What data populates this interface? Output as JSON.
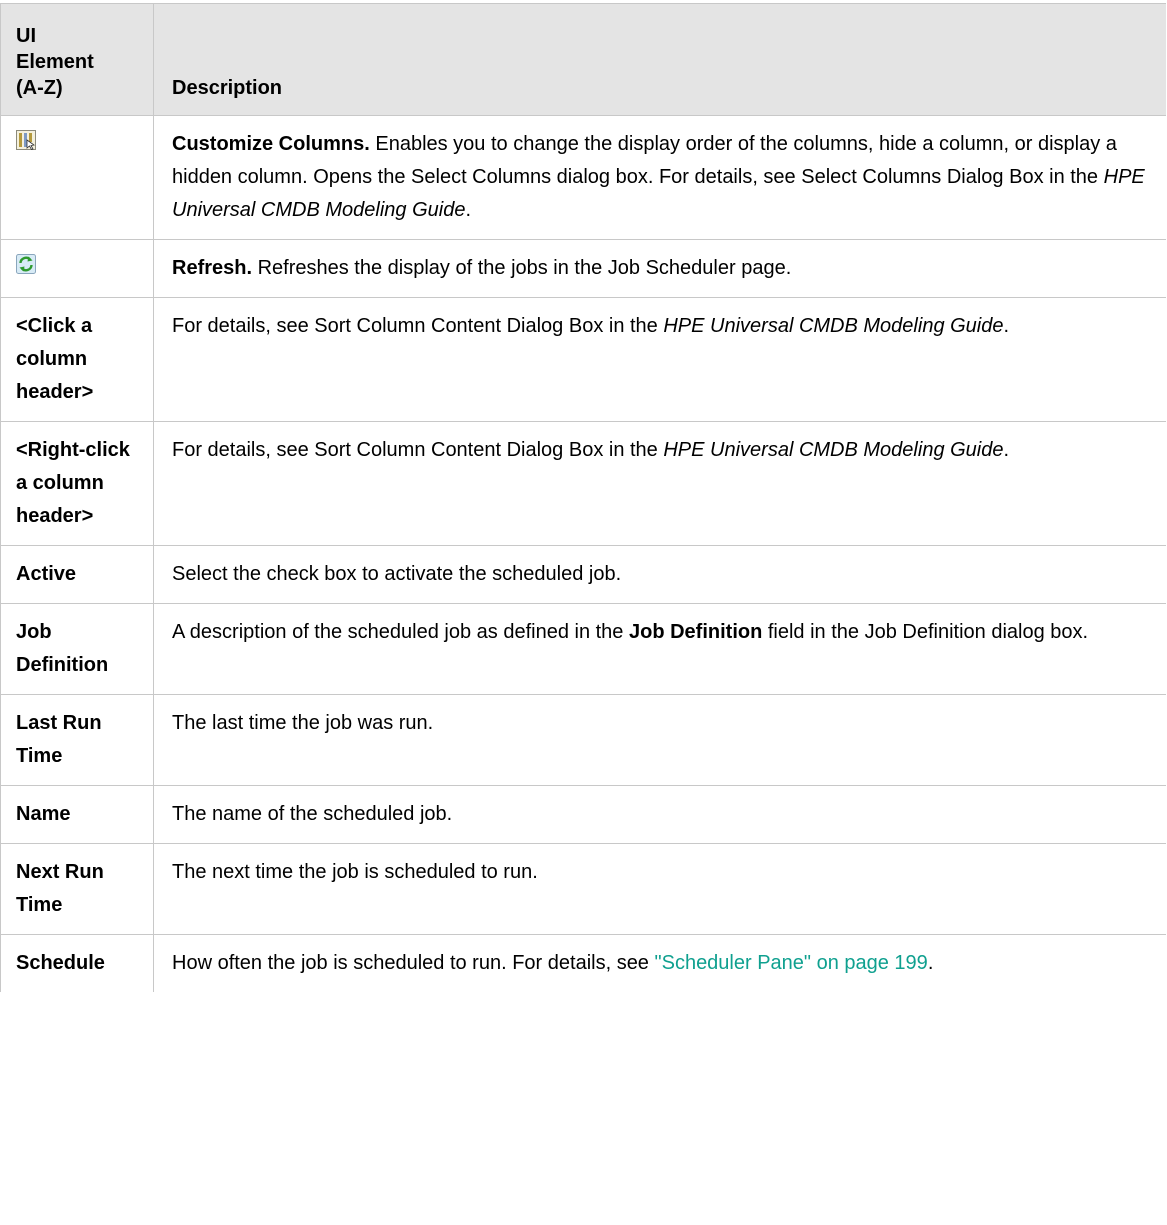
{
  "header": {
    "col1": "UI Element (A-Z)",
    "col1_lines": [
      "UI",
      "Element",
      "(A-Z)"
    ],
    "col2": "Description"
  },
  "rows": [
    {
      "element_icon": "customize-columns-icon",
      "bold": "Customize Columns.",
      "text": " Enables you to change the display order of the columns, hide a column, or display a hidden column. Opens the Select Columns dialog box. For details, see Select Columns Dialog Box in the ",
      "italic": "HPE Universal CMDB Modeling Guide",
      "end": "."
    },
    {
      "element_icon": "refresh-icon",
      "bold": "Refresh.",
      "text": " Refreshes the display of the jobs in the Job Scheduler page."
    },
    {
      "element": "<Click a column header>",
      "text": "For details, see Sort Column Content Dialog Box in the ",
      "italic": "HPE Universal CMDB Modeling Guide",
      "end": "."
    },
    {
      "element": "<Right-click a column header>",
      "text": "For details, see Sort Column Content Dialog Box in the ",
      "italic": "HPE Universal CMDB Modeling Guide",
      "end": "."
    },
    {
      "element": "Active",
      "text": "Select the check box to activate the scheduled job."
    },
    {
      "element": "Job Definition",
      "text": "A description of the scheduled job as defined in the ",
      "bold": "Job Definition",
      "end": " field in the Job Definition dialog box."
    },
    {
      "element": "Last Run Time",
      "text": "The last time the job was run."
    },
    {
      "element": "Name",
      "text": "The name of the scheduled job."
    },
    {
      "element": "Next Run Time",
      "text": "The next time the job is scheduled to run."
    },
    {
      "element": "Schedule",
      "text": "How often the job is scheduled to run. For details, see ",
      "link": "\"Scheduler Pane\" on page 199",
      "end": "."
    }
  ],
  "colors": {
    "header_bg": "#e4e4e4",
    "border": "#c8c8c8",
    "link": "#0fa08f"
  }
}
